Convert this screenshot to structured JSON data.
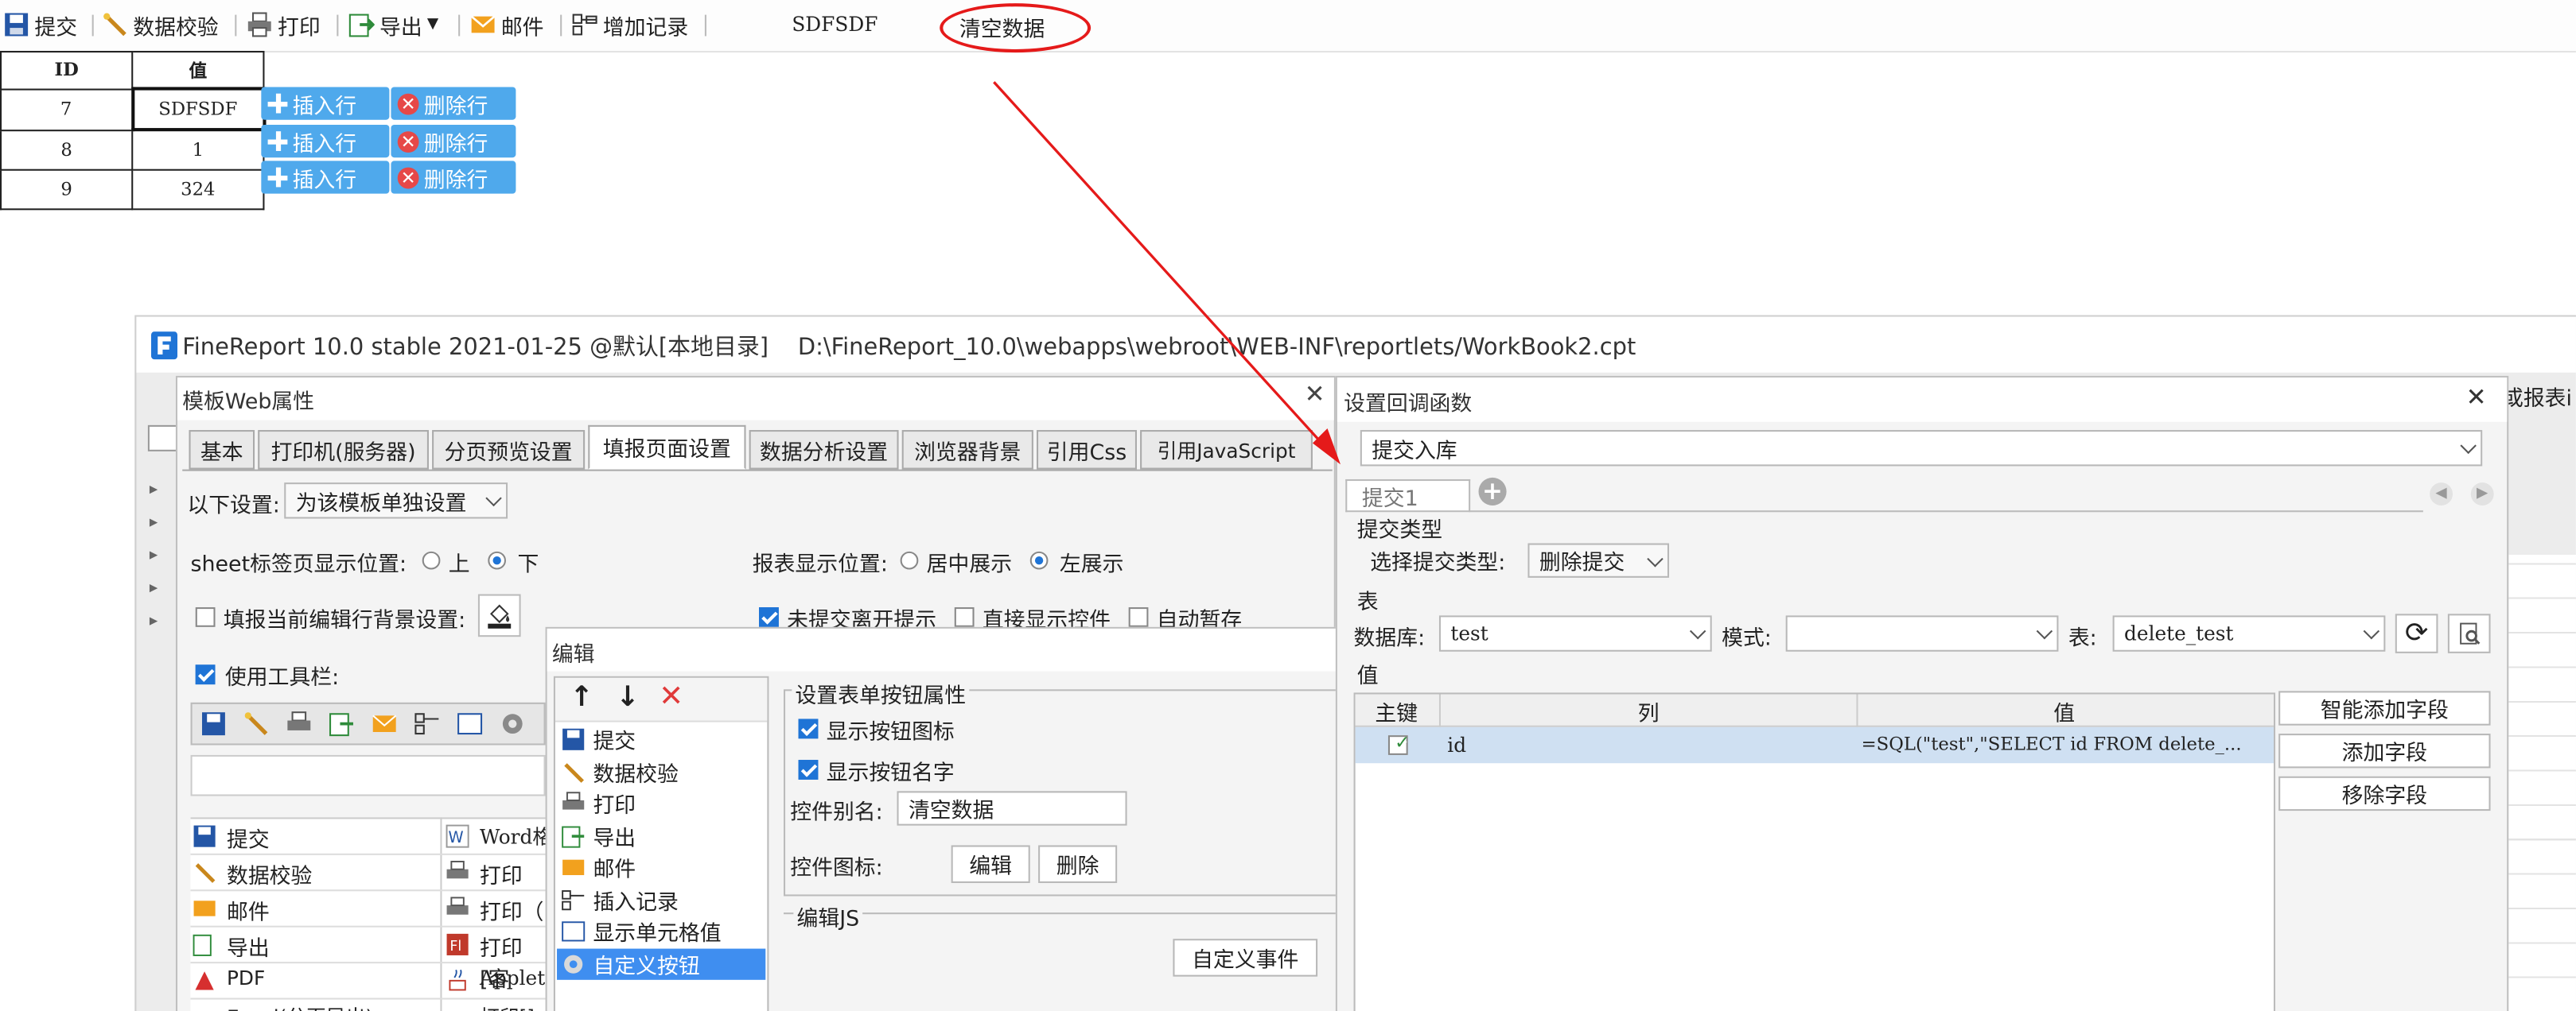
{
  "toolbar": {
    "items": [
      {
        "label": "提交",
        "icon": "save-icon"
      },
      {
        "label": "数据校验",
        "icon": "check-wand-icon"
      },
      {
        "label": "打印",
        "icon": "printer-icon"
      },
      {
        "label": "导出",
        "icon": "export-icon"
      },
      {
        "label": "邮件",
        "icon": "mail-icon"
      },
      {
        "label": "增加记录",
        "icon": "add-record-icon"
      }
    ],
    "field_text": "SDFSDF",
    "clear_label": "清空数据"
  },
  "table": {
    "headers": [
      "ID",
      "值"
    ],
    "rows": [
      {
        "id": "7",
        "value": "SDFSDF"
      },
      {
        "id": "8",
        "value": "1"
      },
      {
        "id": "9",
        "value": "324"
      }
    ],
    "insert_label": "插入行",
    "delete_label": "删除行"
  },
  "main_window": {
    "title": "FineReport 10.0 stable 2021-01-25 @默认[本地目录]    D:\\FineReport_10.0\\webapps\\webroot\\WEB-INF\\reportlets/WorkBook2.cpt",
    "right_fragment": "或报表i"
  },
  "web_dialog": {
    "title": "模板Web属性",
    "tabs": [
      "基本",
      "打印机(服务器)",
      "分页预览设置",
      "填报页面设置",
      "数据分析设置",
      "浏览器背景",
      "引用Css",
      "引用JavaScript"
    ],
    "active_tab": "填报页面设置",
    "settings_label": "以下设置:",
    "settings_value": "为该模板单独设置",
    "sheet_pos_label": "sheet标签页显示位置:",
    "sheet_pos_top": "上",
    "sheet_pos_bottom": "下",
    "report_pos_label": "报表显示位置:",
    "report_pos_center": "居中展示",
    "report_pos_left": "左展示",
    "fill_bg_label": "填报当前编辑行背景设置:",
    "unsubmitted_label": "未提交离开提示",
    "show_controls_label": "直接显示控件",
    "autosave_label": "自动暂存",
    "use_toolbar_label": "使用工具栏:",
    "left_list": [
      "提交",
      "数据校验",
      "邮件",
      "导出",
      "PDF",
      "Excel(分页导出)"
    ],
    "right_list": [
      "Word格",
      "打印",
      "打印（",
      "打印[客",
      "Applet",
      "打印[]"
    ]
  },
  "edit_dialog": {
    "title": "编辑",
    "items": [
      "提交",
      "数据校验",
      "打印",
      "导出",
      "邮件",
      "插入记录",
      "显示单元格值",
      "自定义按钮"
    ],
    "selected": "自定义按钮",
    "group_title": "设置表单按钮属性",
    "show_icon_label": "显示按钮图标",
    "show_name_label": "显示按钮名字",
    "alias_label": "控件别名:",
    "alias_value": "清空数据",
    "icon_label": "控件图标:",
    "edit_btn": "编辑",
    "delete_btn": "删除",
    "js_label": "编辑JS",
    "custom_event": "自定义事件"
  },
  "callback_dialog": {
    "title": "设置回调函数",
    "type_value": "提交入库",
    "tab_label": "提交1",
    "submit_type_group": "提交类型",
    "submit_type_label": "选择提交类型:",
    "submit_type_value": "删除提交",
    "table_group": "表",
    "db_label": "数据库:",
    "db_value": "test",
    "schema_label": "模式:",
    "schema_value": "",
    "table_label": "表:",
    "table_value": "delete_test",
    "value_group": "值",
    "col_pk": "主键",
    "col_column": "列",
    "col_value": "值",
    "row_column": "id",
    "row_value": "=SQL(\"test\",\"SELECT id FROM delete_...",
    "smart_add": "智能添加字段",
    "add_field": "添加字段",
    "remove_field": "移除字段"
  },
  "colors": {
    "accent": "#1f74d6",
    "row_button": "#4fa9ec",
    "annotation": "#e51a1a"
  }
}
